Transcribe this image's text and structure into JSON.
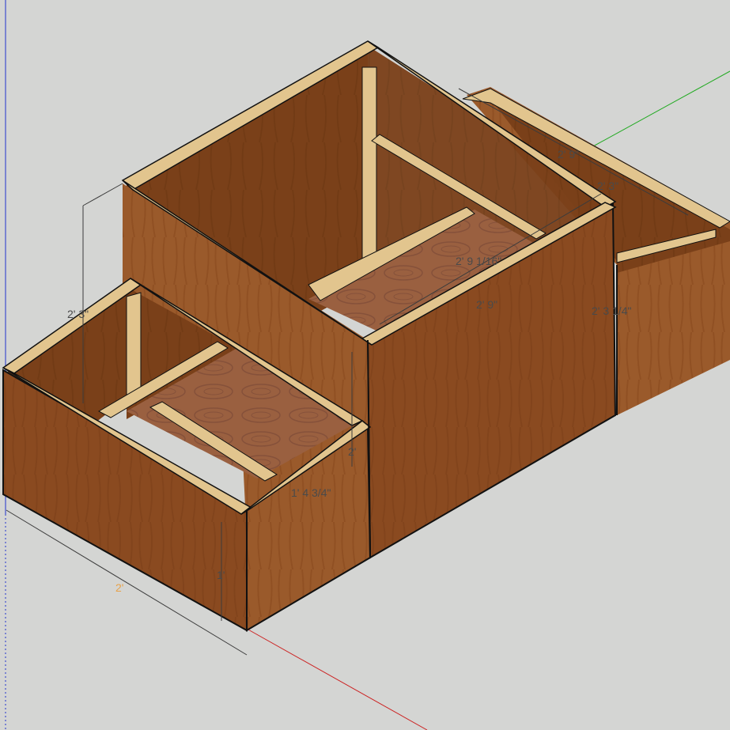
{
  "app": "3D modeling viewport",
  "colors": {
    "background": "#d4d5d3",
    "plywood_front": "#8a4a20",
    "plywood_side": "#9a5a2b",
    "plywood_inner": "#7a4019",
    "floor": "#9a6040",
    "stud": "#e2c58e",
    "axis_red": "#cc2222",
    "axis_green": "#22aa22",
    "axis_blue": "#2233cc",
    "dim_orange": "#e7a24a"
  },
  "dimensions": {
    "total_height": "2' 3\"",
    "top_depth": "2' 9\"",
    "small_gap": "2' 3\"",
    "inner_length": "2' 9 1/16\"",
    "front_length": "2' 9\"",
    "right_height": "2' 3 1/4\"",
    "step_height": "2'",
    "low_depth": "1' 4 3/4\"",
    "low_height": "1'",
    "base_width": "2'"
  }
}
